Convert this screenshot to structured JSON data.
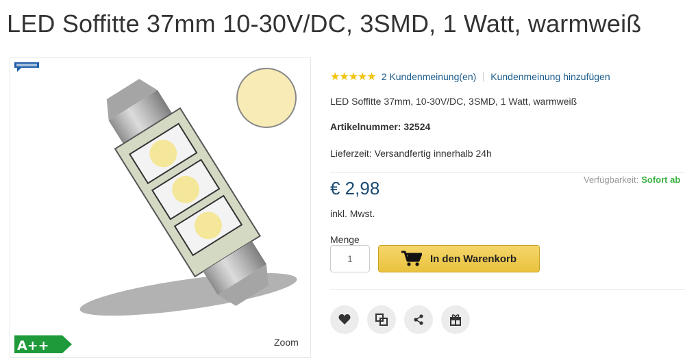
{
  "product": {
    "title": "LED Soffitte 37mm 10-30V/DC, 3SMD, 1 Watt, warmweiß",
    "rating": 5,
    "reviews_link": "2 Kundenmeinung(en)",
    "add_review_link": "Kundenmeinung hinzufügen",
    "short_description": "LED Soffitte 37mm, 10-30V/DC, 3SMD, 1 Watt, warmweiß",
    "article_number": "Artikelnummer: 32524",
    "delivery": "Lieferzeit: Versandfertig innerhalb 24h",
    "availability_label": "Verfügbarkeit:",
    "availability_value": "Sofort ab",
    "price": "€ 2,98",
    "tax_note": "inkl. Mwst.",
    "quantity_label": "Menge",
    "quantity_value": "1",
    "cart_button": "In den Warenkorb"
  },
  "gallery": {
    "energy_class": "A++",
    "zoom_label": "Zoom",
    "swatch_color": "#f8ebb5"
  },
  "actions": [
    {
      "name": "wishlist-icon"
    },
    {
      "name": "compare-icon"
    },
    {
      "name": "share-icon"
    },
    {
      "name": "gift-icon"
    }
  ]
}
